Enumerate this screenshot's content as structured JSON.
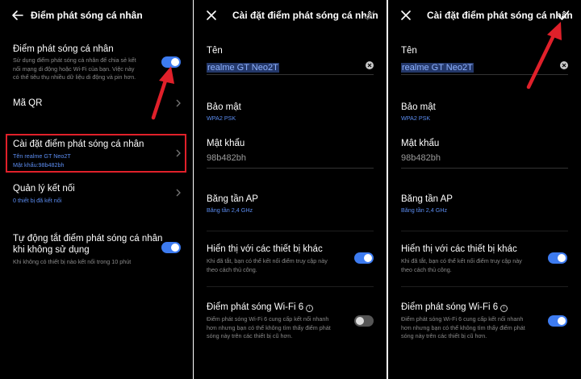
{
  "screen1": {
    "title": "Điểm phát sóng cá nhân",
    "hotspot": {
      "title": "Điểm phát sóng cá nhân",
      "desc1": "Sử dụng điểm phát sóng cá nhân để chia sẻ kết",
      "desc2": "nối mạng di động hoặc Wi-Fi của bạn. Việc này",
      "desc3": "có thể tiêu thụ nhiều dữ liệu di động và pin hơn.",
      "enabled": true
    },
    "qr": {
      "title": "Mã QR"
    },
    "settings": {
      "title": "Cài đặt điểm phát sóng cá nhân",
      "name_line": "Tên realme GT Neo2T",
      "password_line": "Mật khẩu:98b482bh"
    },
    "connections": {
      "title": "Quản lý kết nối",
      "desc": "0 thiết bị đã kết nối"
    },
    "auto_off": {
      "title1": "Tự động tắt điểm phát sóng cá nhân",
      "title2": "khi không sử dụng",
      "desc": "Khi không có thiết bị nào kết nối trong 10 phút",
      "enabled": true
    }
  },
  "screen2": {
    "title": "Cài đặt điểm phát sóng cá nhân",
    "name_label": "Tên",
    "name_value": "realme GT Neo2T",
    "security_label": "Bảo mật",
    "security_value": "WPA2 PSK",
    "password_label": "Mật khẩu",
    "password_value": "98b482bh",
    "band_label": "Băng tần AP",
    "band_value": "Băng tần 2,4 GHz",
    "visible_title": "Hiển thị với các thiết bị khác",
    "visible_desc1": "Khi đã tắt, bạn có thể kết nối điểm truy cập này",
    "visible_desc2": "theo cách thủ công.",
    "visible_enabled": true,
    "wifi6_title": "Điểm phát sóng Wi-Fi 6",
    "wifi6_desc1": "Điểm phát sóng Wi-Fi 6 cung cấp kết nối nhanh",
    "wifi6_desc2": "hơn nhưng bạn có thể không tìm thấy điểm phát",
    "wifi6_desc3": "sóng này trên các thiết bị cũ hơn.",
    "wifi6_enabled": false
  },
  "screen3": {
    "title": "Cài đặt điểm phát sóng cá nhân",
    "name_label": "Tên",
    "name_value": "realme GT Neo2T",
    "security_label": "Bảo mật",
    "security_value": "WPA2 PSK",
    "password_label": "Mật khẩu",
    "password_value": "98b482bh",
    "band_label": "Băng tần AP",
    "band_value": "Băng tần 2,4 GHz",
    "visible_title": "Hiển thị với các thiết bị khác",
    "visible_desc1": "Khi đã tắt, bạn có thể kết nối điểm truy cập này",
    "visible_desc2": "theo cách thủ công.",
    "visible_enabled": true,
    "wifi6_title": "Điểm phát sóng Wi-Fi 6",
    "wifi6_desc1": "Điểm phát sóng Wi-Fi 6 cung cấp kết nối nhanh",
    "wifi6_desc2": "hơn nhưng bạn có thể không tìm thấy điểm phát",
    "wifi6_desc3": "sóng này trên các thiết bị cũ hơn.",
    "wifi6_enabled": true
  },
  "colors": {
    "accent": "#3d7bf0",
    "highlight": "#e0202a",
    "background": "#000000"
  },
  "icons": [
    "back-arrow-icon",
    "close-icon",
    "check-icon",
    "chevron-right-icon",
    "clear-text-icon",
    "info-icon"
  ]
}
